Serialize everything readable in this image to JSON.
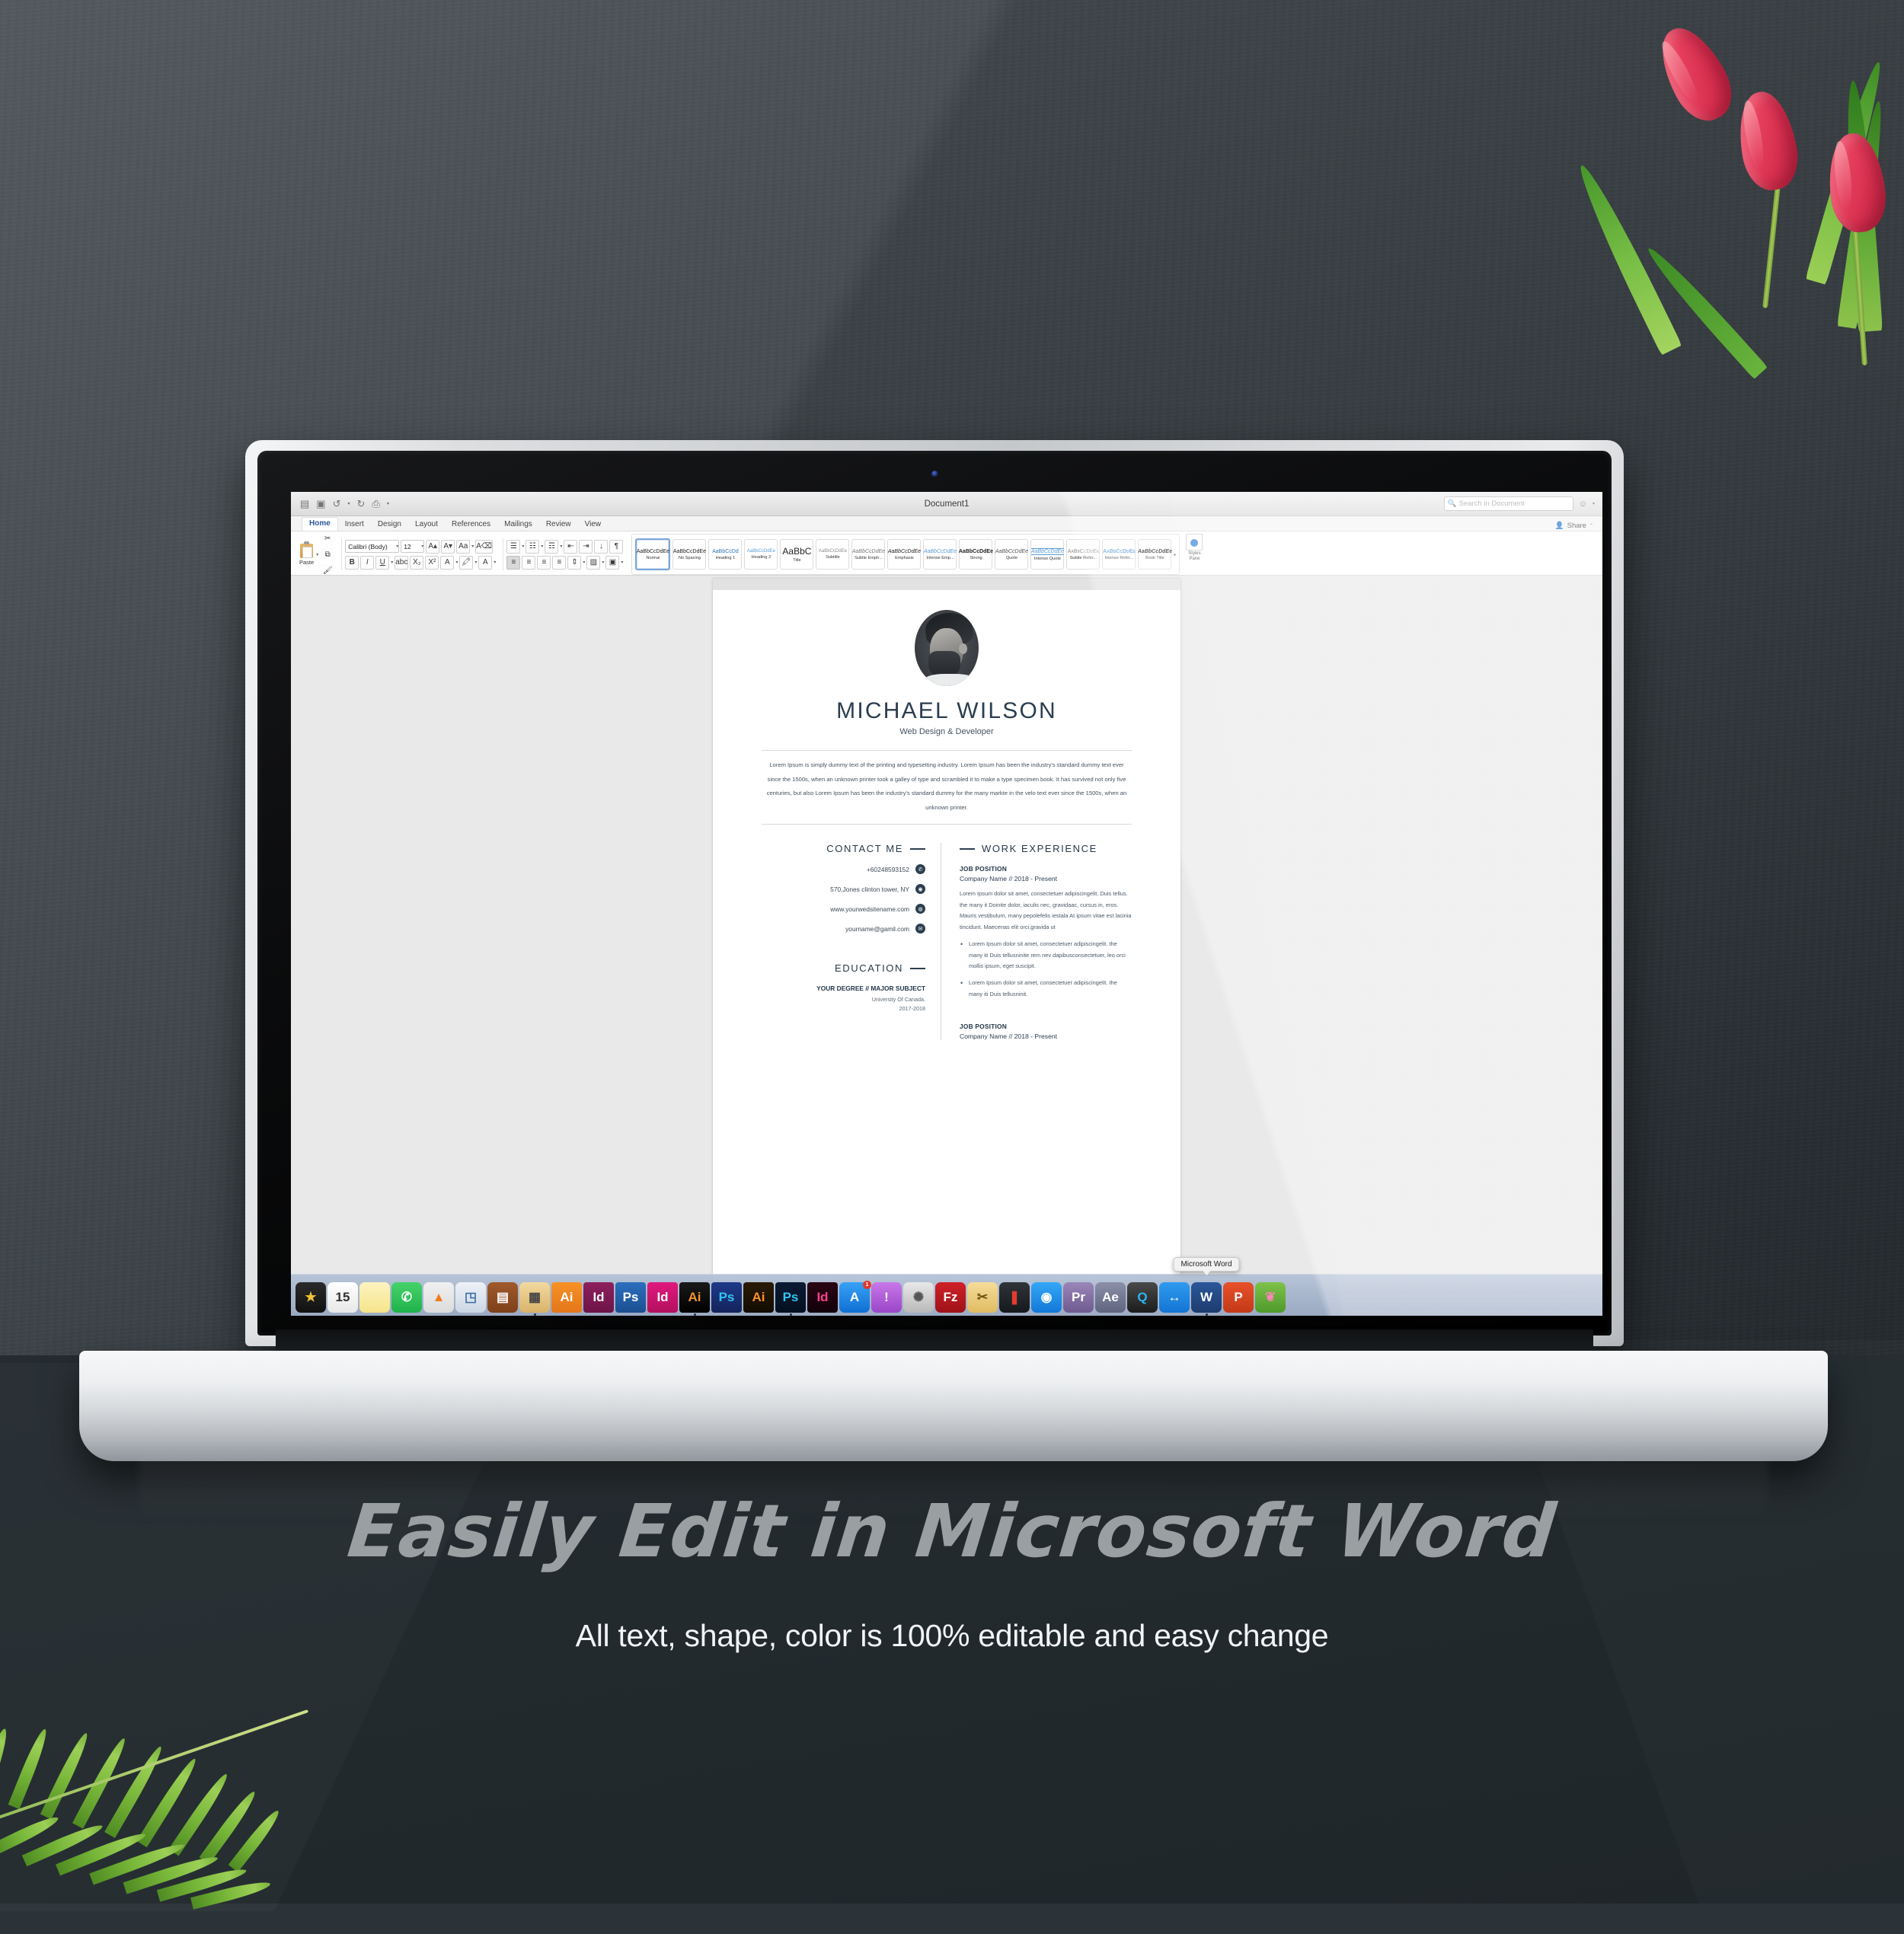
{
  "scene": {
    "background_color": "#2b3338",
    "accent_color": "#2b3e4f"
  },
  "marketing": {
    "headline": "Easily Edit in Microsoft Word",
    "subline": "All text, shape, color is 100% editable and easy change"
  },
  "word": {
    "title": "Document1",
    "quick_access": [
      "new-doc-icon",
      "save-icon",
      "undo-icon",
      "redo-icon",
      "print-icon",
      "customize-icon"
    ],
    "search": {
      "placeholder": "Search in Document",
      "icon": "search-icon"
    },
    "share_label": "Share",
    "tabs": [
      {
        "label": "Home",
        "active": true
      },
      {
        "label": "Insert",
        "active": false
      },
      {
        "label": "Design",
        "active": false
      },
      {
        "label": "Layout",
        "active": false
      },
      {
        "label": "References",
        "active": false
      },
      {
        "label": "Mailings",
        "active": false
      },
      {
        "label": "Review",
        "active": false
      },
      {
        "label": "View",
        "active": false
      }
    ],
    "clipboard": {
      "paste_label": "Paste"
    },
    "font": {
      "family": "Calibri (Body)",
      "size": "12"
    },
    "styles_pane_label_1": "Styles",
    "styles_pane_label_2": "Pane",
    "styles": [
      {
        "preview": "AaBbCcDdEe",
        "name": "Normal",
        "selected": true
      },
      {
        "preview": "AaBbCcDdEe",
        "name": "No Spacing",
        "selected": false
      },
      {
        "preview": "AaBbCcDd",
        "name": "Heading 1",
        "selected": false
      },
      {
        "preview": "AaBbCcDdEe",
        "name": "Heading 2",
        "selected": false
      },
      {
        "preview": "AaBbC",
        "name": "Title",
        "selected": false
      },
      {
        "preview": "AaBbCcDdEe",
        "name": "Subtitle",
        "selected": false
      },
      {
        "preview": "AaBbCcDdEe",
        "name": "Subtle Emph...",
        "selected": false
      },
      {
        "preview": "AaBbCcDdEe",
        "name": "Emphasis",
        "selected": false
      },
      {
        "preview": "AaBbCcDdEe",
        "name": "Intense Emp...",
        "selected": false
      },
      {
        "preview": "AaBbCcDdEe",
        "name": "Strong",
        "selected": false
      },
      {
        "preview": "AaBbCcDdEe",
        "name": "Quote",
        "selected": false
      },
      {
        "preview": "AaBbCcDdEe",
        "name": "Intense Quote",
        "selected": false
      },
      {
        "preview": "AaBbCcDdEe",
        "name": "Subtle Refer...",
        "selected": false
      },
      {
        "preview": "AaBbCcDdEe",
        "name": "Intense Refer...",
        "selected": false
      },
      {
        "preview": "AaBbCcDdEe",
        "name": "Book Title",
        "selected": false
      }
    ]
  },
  "resume": {
    "name": "MICHAEL WILSON",
    "subtitle": "Web Design & Developer",
    "intro": "Lorem Ipsum is simply dummy text of the printing and typesetting industry. Lorem Ipsum has been the industry's standard dummy text ever since the 1500s, when an unknown printer took a galley of type and scrambled it to make a type specimen book. It has survived not only five centuries, but also Lorem Ipsum has been the industry's standard dummy for the many markte in the velo text ever since the 1500s, when an unknown printer.",
    "contact_heading": "CONTACT ME",
    "contact": [
      {
        "value": "+60248593152",
        "icon": "phone-icon"
      },
      {
        "value": "570,Jones clinton tower, NY",
        "icon": "location-pin-icon"
      },
      {
        "value": "www.yourwedsitename.com",
        "icon": "globe-icon"
      },
      {
        "value": "yourname@gamil.com",
        "icon": "envelope-icon"
      }
    ],
    "education_heading": "EDUCATION",
    "education": {
      "degree": "YOUR DEGREE // MAJOR SUBJECT",
      "school": "University Of Canada.",
      "years": "2017-2018"
    },
    "work_heading": "WORK EXPERIENCE",
    "jobs": [
      {
        "position": "JOB POSITION",
        "company": "Company Name  //  2018 - Present",
        "description": "Lorem Ipsum dolor sit amet, consectetuer adipiscingelit. Duis tellus. the many it Doinite dolor, iaculis nec, gravidaac, cursus in, eros. Mauris vestibulum, many pepolefelis iestala At ipsum vitae est lacinia tincidunt. Maecenas elit orci,gravida ut",
        "bullets": [
          "Lorem Ipsum dolor sit amet, consectetuer adipiscingelit. the many iti Duis tellusninite rem nev dapibusconsectetuer, leo orci mollis ipsum, eget suscipit.",
          "Lorem Ipsum dolor sit amet, consectetuer adipiscingelit. the many iti Duis tellusninit."
        ]
      },
      {
        "position": "JOB POSITION",
        "company": "Company Name  //  2018 - Present",
        "description": "",
        "bullets": []
      }
    ]
  },
  "dock": {
    "tooltip": "Microsoft Word",
    "items": [
      {
        "name": "imovie-icon",
        "glyph": "★",
        "bg": "linear-gradient(180deg,#2b2b2b,#111)",
        "color": "#f0c33a",
        "running": false
      },
      {
        "name": "calendar-icon",
        "glyph": "15",
        "bg": "linear-gradient(180deg,#ffffff,#e8e8e8)",
        "color": "#333",
        "running": false
      },
      {
        "name": "notes-icon",
        "glyph": "",
        "bg": "linear-gradient(180deg,#fdf3c0,#f6e48a)",
        "color": "#8a7a20",
        "running": false
      },
      {
        "name": "facetime-icon",
        "glyph": "✆",
        "bg": "linear-gradient(180deg,#46d26b,#1fb24a)",
        "color": "#fff",
        "running": false
      },
      {
        "name": "vlc-icon",
        "glyph": "▲",
        "bg": "linear-gradient(180deg,#f0f0f0,#dcdcdc)",
        "color": "#f07c1e",
        "running": false
      },
      {
        "name": "keynote-icon",
        "glyph": "◳",
        "bg": "linear-gradient(180deg,#eef2f7,#cbd6e4)",
        "color": "#3c6ea5",
        "running": false
      },
      {
        "name": "preview-icon",
        "glyph": "▤",
        "bg": "linear-gradient(180deg,#a05a2c,#7d401a)",
        "color": "#fff",
        "running": false
      },
      {
        "name": "calculator-icon",
        "glyph": "▦",
        "bg": "linear-gradient(180deg,#f2d9a0,#d9b36a)",
        "color": "#444",
        "running": true
      },
      {
        "name": "illustrator-icon",
        "glyph": "Ai",
        "bg": "linear-gradient(180deg,#f79226,#e3761a)",
        "color": "#fff",
        "running": false
      },
      {
        "name": "indesign-icon",
        "glyph": "Id",
        "bg": "linear-gradient(180deg,#8e1f5e,#6d1448)",
        "color": "#fff",
        "running": false
      },
      {
        "name": "photoshop-icon",
        "glyph": "Ps",
        "bg": "linear-gradient(180deg,#2b6fbe,#1c4f91)",
        "color": "#fff",
        "running": false
      },
      {
        "name": "indesign-cc-icon",
        "glyph": "Id",
        "bg": "linear-gradient(180deg,#e0197e,#b3105f)",
        "color": "#fff",
        "running": false
      },
      {
        "name": "illustrator-cc-icon",
        "glyph": "Ai",
        "bg": "linear-gradient(180deg,#1a1a1a,#000)",
        "color": "#f79226",
        "running": true
      },
      {
        "name": "photoshop-cs-icon",
        "glyph": "Ps",
        "bg": "linear-gradient(180deg,#1e3a8a,#14235c)",
        "color": "#31c5f0",
        "running": false
      },
      {
        "name": "illustrator-cs-icon",
        "glyph": "Ai",
        "bg": "linear-gradient(180deg,#2a1a05,#120c02)",
        "color": "#f79226",
        "running": false
      },
      {
        "name": "photoshop-cc-icon",
        "glyph": "Ps",
        "bg": "linear-gradient(180deg,#0b1a33,#031021)",
        "color": "#31c5f0",
        "running": true
      },
      {
        "name": "indesign-cs-icon",
        "glyph": "Id",
        "bg": "linear-gradient(180deg,#2a0412,#12020a)",
        "color": "#ff3f8e",
        "running": false
      },
      {
        "name": "app-store-icon",
        "glyph": "A",
        "bg": "linear-gradient(180deg,#38a1f5,#0f6fd4)",
        "color": "#fff",
        "running": false,
        "badge": "1"
      },
      {
        "name": "alert-icon",
        "glyph": "!",
        "bg": "linear-gradient(180deg,#c878e8,#9a46c9)",
        "color": "#fff",
        "running": false
      },
      {
        "name": "system-preferences-icon",
        "glyph": "✺",
        "bg": "linear-gradient(180deg,#e8e8e8,#b9b9b9)",
        "color": "#555",
        "running": false
      },
      {
        "name": "filezilla-icon",
        "glyph": "Fz",
        "bg": "linear-gradient(180deg,#cf2127,#9e1319)",
        "color": "#fff",
        "running": false
      },
      {
        "name": "unarchiver-icon",
        "glyph": "✂",
        "bg": "linear-gradient(180deg,#f6dc9a,#e0bc62)",
        "color": "#6a5310",
        "running": false
      },
      {
        "name": "folx-icon",
        "glyph": "❚",
        "bg": "linear-gradient(180deg,#2f3439,#16191c)",
        "color": "#e53b2f",
        "running": false
      },
      {
        "name": "shareit-icon",
        "glyph": "◉",
        "bg": "linear-gradient(180deg,#35a7f7,#1179d8)",
        "color": "#fff",
        "running": false
      },
      {
        "name": "premiere-icon",
        "glyph": "Pr",
        "bg": "linear-gradient(180deg,#9a86b8,#6f5a90)",
        "color": "#fff",
        "running": false
      },
      {
        "name": "after-effects-icon",
        "glyph": "Ae",
        "bg": "linear-gradient(180deg,#8b8fa8,#5f6480)",
        "color": "#fff",
        "running": false
      },
      {
        "name": "quicktime-icon",
        "glyph": "Q",
        "bg": "linear-gradient(180deg,#4a4a4a,#1c1c1c)",
        "color": "#29b6f6",
        "running": false
      },
      {
        "name": "teamviewer-icon",
        "glyph": "↔",
        "bg": "linear-gradient(180deg,#2f9bf0,#1474d4)",
        "color": "#fff",
        "running": false
      },
      {
        "name": "word-icon",
        "glyph": "W",
        "bg": "linear-gradient(180deg,#2b579a,#1d3c6e)",
        "color": "#fff",
        "running": true
      },
      {
        "name": "powerpoint-icon",
        "glyph": "P",
        "bg": "linear-gradient(180deg,#e8502a,#c23a18)",
        "color": "#fff",
        "running": false
      },
      {
        "name": "parrot-icon",
        "glyph": "❦",
        "bg": "linear-gradient(180deg,#7ec24a,#4f9a2c)",
        "color": "#ff86b8",
        "running": false
      }
    ]
  }
}
